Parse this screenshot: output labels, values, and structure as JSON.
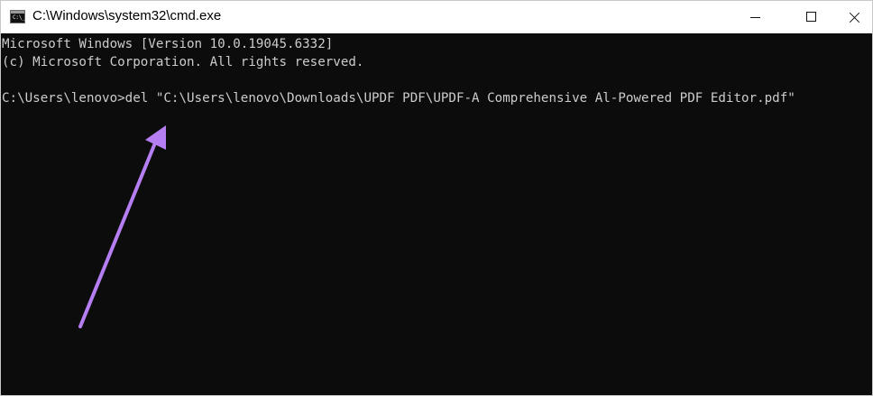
{
  "window": {
    "title": "C:\\Windows\\system32\\cmd.exe",
    "icon_label": "C:\\_",
    "buttons": [
      {
        "name": "minimize",
        "glyph": "minimize-icon"
      },
      {
        "name": "maximize",
        "glyph": "maximize-icon"
      },
      {
        "name": "close",
        "glyph": "close-icon"
      }
    ]
  },
  "console": {
    "lines": [
      "Microsoft Windows [Version 10.0.19045.6332]",
      "(c) Microsoft Corporation. All rights reserved.",
      "",
      "C:\\Users\\lenovo>del \"C:\\Users\\lenovo\\Downloads\\UPDF PDF\\UPDF-A Comprehensive Al-Powered PDF Editor.pdf\""
    ]
  },
  "annotation": {
    "color": "#b57ef2",
    "icon": "annotation-arrow"
  }
}
